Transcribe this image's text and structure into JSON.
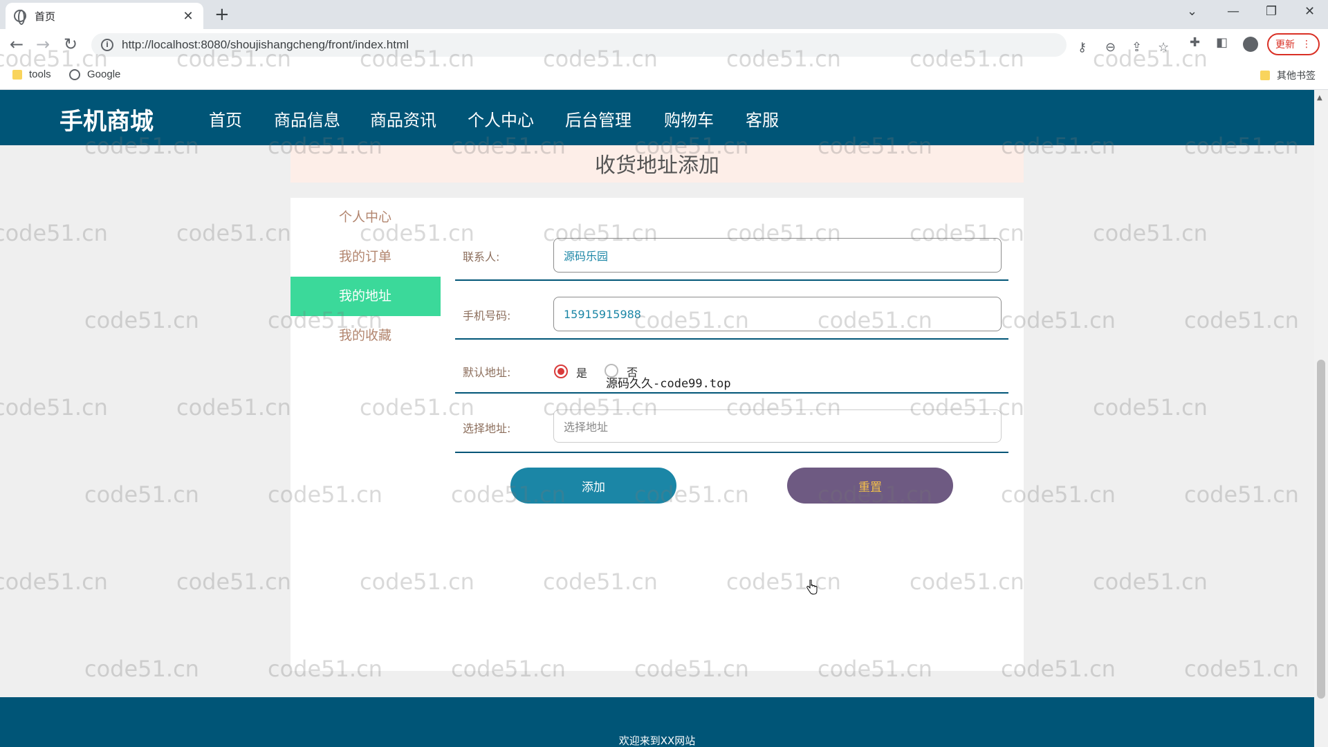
{
  "browser": {
    "tab_title": "首页",
    "tab_close": "✕",
    "new_tab": "+",
    "url": "http://localhost:8080/shoujishangcheng/front/index.html",
    "update_label": "更新",
    "bookmarks": [
      "tools",
      "Google"
    ],
    "other_bookmarks": "其他书签"
  },
  "site": {
    "logo": "手机商城",
    "nav": [
      "首页",
      "商品信息",
      "商品资讯",
      "个人中心",
      "后台管理",
      "购物车",
      "客服"
    ],
    "active_nav_index": 3,
    "page_title": "收货地址添加",
    "sidebar": [
      "个人中心",
      "我的订单",
      "我的地址",
      "我的收藏"
    ],
    "active_sidebar_index": 2,
    "form": {
      "contact_label": "联系人:",
      "contact_value": "源码乐园",
      "phone_label": "手机号码:",
      "phone_value": "15915915988",
      "default_label": "默认地址:",
      "default_yes": "是",
      "default_no": "否",
      "default_selected": "是",
      "address_label": "选择地址:",
      "address_placeholder": "选择地址",
      "add_button": "添加",
      "reset_button": "重置"
    },
    "overlay_text": "源码久久-code99.top",
    "footer_text": "欢迎来到XX网站"
  },
  "watermark_text": "code51.cn",
  "colors": {
    "header": "#005577",
    "sidebar_active": "#3bd99a",
    "add_button": "#1b86a6",
    "reset_button": "#6e5a82",
    "reset_text": "#f5c04a",
    "banner": "#fdeee8"
  }
}
